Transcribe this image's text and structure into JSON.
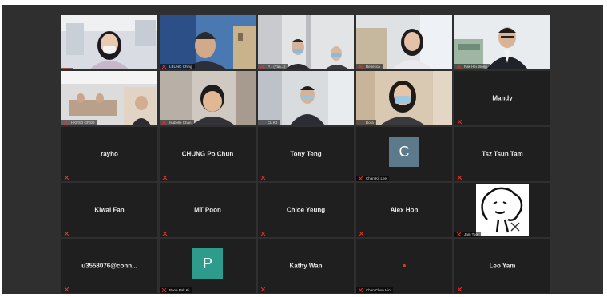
{
  "meeting": {
    "row1": [
      {
        "caption": "",
        "muted": true
      },
      {
        "caption": "LEUNG Ching",
        "muted": true
      },
      {
        "caption": "P... (Yan...)",
        "muted": true
      },
      {
        "caption": "Rebecca",
        "muted": true
      },
      {
        "caption": "Pak Hei Wong",
        "muted": true
      }
    ],
    "row2": [
      {
        "caption": "HKFSD GPSO",
        "muted": true
      },
      {
        "caption": "Isabelle Chan",
        "muted": true
      },
      {
        "caption": "CL Kit",
        "muted": false
      },
      {
        "caption": "Dora",
        "muted": false
      },
      {
        "name": "Mandy",
        "muted": true
      }
    ],
    "row3": [
      {
        "name": "rayho",
        "muted": true
      },
      {
        "name": "CHUNG Po Chun",
        "muted": true
      },
      {
        "name": "Tony Teng",
        "muted": true
      },
      {
        "avatar_letter": "C",
        "avatar_color": "#5c7a8c",
        "caption": "Chan Kit Lee",
        "muted": true
      },
      {
        "name": "Tsz Tsun Tam",
        "muted": true
      }
    ],
    "row4": [
      {
        "name": "Kiwai Fan",
        "muted": true
      },
      {
        "name": "MT Poon",
        "muted": true
      },
      {
        "name": "Chloe Yeung",
        "muted": true
      },
      {
        "name": "Alex Hon",
        "muted": true
      },
      {
        "caption": "Jam Tsoi",
        "muted": true
      }
    ],
    "row5": [
      {
        "name": "u3558076@conn...",
        "muted": true
      },
      {
        "avatar_letter": "P",
        "avatar_color": "#2e9c8c",
        "caption": "Poon Pak Ki",
        "muted": true
      },
      {
        "name": "Kathy Wan",
        "muted": true
      },
      {
        "caption": "Chan Chun Hin",
        "muted": true
      },
      {
        "name": "Leo Yam",
        "muted": true
      }
    ]
  }
}
